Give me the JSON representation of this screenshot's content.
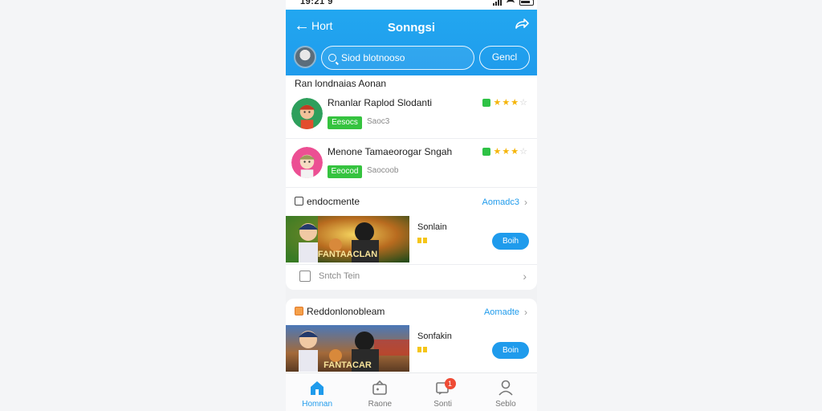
{
  "status_bar": {
    "time": "19:21 9"
  },
  "app_bar": {
    "back_label": "Hort",
    "title": "Sonngsi"
  },
  "search": {
    "placeholder": "Siod blotnooso",
    "cancel_label": "Gencl"
  },
  "results_section": {
    "heading": "Ran londnaias Aonan",
    "items": [
      {
        "name": "Rnanlar Raplod Slodanti",
        "tag": "Eesocs",
        "meta": "Saoc3",
        "stars_filled": 3,
        "stars_total": 4
      },
      {
        "name": "Menone Tamaeorogar Sngah",
        "tag": "Eeocod",
        "meta": "Saocoob",
        "stars_filled": 3,
        "stars_total": 4
      }
    ]
  },
  "block_one": {
    "title": "endocmente",
    "more_label": "Aomadc3",
    "game": {
      "title": "Sonlain",
      "thumb_text": "FANTAACLAN",
      "button_label": "Boih"
    },
    "footer_label": "Sntch Tein"
  },
  "block_two": {
    "title": "Reddonlonobleam",
    "more_label": "Aomadte",
    "game": {
      "title": "Sonfakin",
      "thumb_text": "FANTACAR",
      "button_label": "Boin"
    }
  },
  "tab_bar": {
    "tabs": [
      {
        "label": "Homnan",
        "icon": "home-icon",
        "active": true
      },
      {
        "label": "Raone",
        "icon": "games-icon",
        "active": false
      },
      {
        "label": "Sonti",
        "icon": "messages-icon",
        "active": false,
        "badge": "1"
      },
      {
        "label": "Seblo",
        "icon": "profile-icon",
        "active": false
      }
    ]
  },
  "colors": {
    "accent": "#1f9bec",
    "tag_green": "#35c33f",
    "star": "#f5b50a",
    "badge_red": "#ef4b35"
  }
}
